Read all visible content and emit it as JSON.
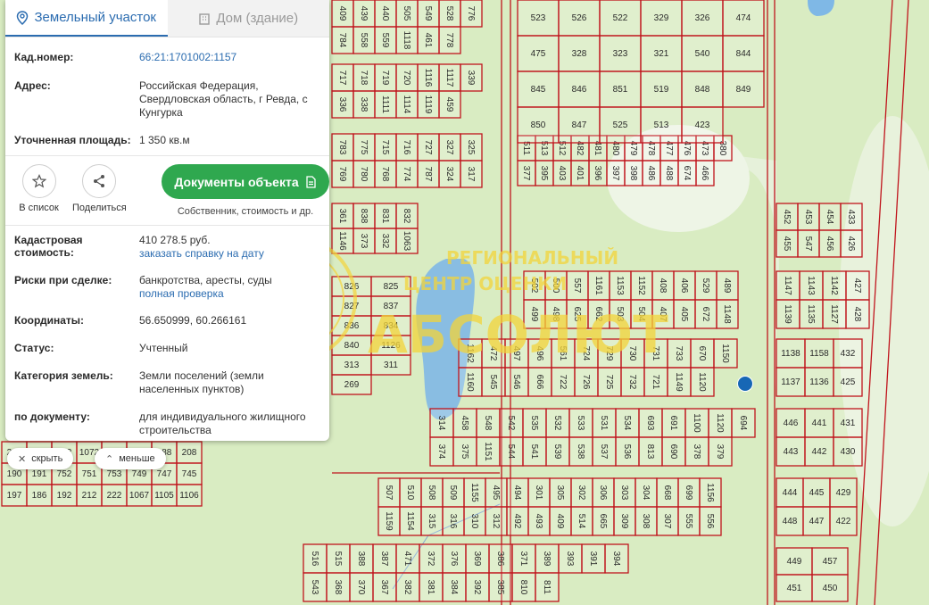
{
  "tabs": [
    {
      "label": "Земельный участок",
      "icon": "location-pin-icon",
      "active": true
    },
    {
      "label": "Дом (здание)",
      "icon": "building-icon",
      "active": false
    }
  ],
  "info": {
    "cad_label": "Кад.номер:",
    "cad_value": "66:21:1701002:1157",
    "addr_label": "Адрес:",
    "addr_value": "Российская Федерация, Свердловская область, г Ревда, с Кунгурка",
    "area_label": "Уточненная площадь:",
    "area_value": "1 350 кв.м",
    "cost_label": "Кадастровая стоимость:",
    "cost_value": "410 278.5 руб.",
    "cost_link": "заказать справку на дату",
    "risk_label": "Риски при сделке:",
    "risk_value": "банкротства, аресты, суды",
    "risk_link": "полная проверка",
    "coord_label": "Координаты:",
    "coord_value": "56.650999, 60.266161",
    "status_label": "Статус:",
    "status_value": "Учтенный",
    "cat_label": "Категория земель:",
    "cat_value": "Земли поселений (земли населенных пунктов)",
    "doc_label": "по документу:",
    "doc_value": "для индивидуального жилищного строительства"
  },
  "actions": {
    "fav_label": "В список",
    "share_label": "Поделиться",
    "docs_button": "Документы объекта",
    "docs_sub": "Собственник, стоимость и др."
  },
  "controls": {
    "hide_label": "скрыть",
    "less_label": "меньше"
  },
  "watermark": {
    "line1": "РЕГИОНАЛЬНЫЙ",
    "line2": "ЦЕНТР ОЦЕНКИ",
    "brand": "АБСОЛЮТ"
  },
  "colors": {
    "accent": "#2b6cb0",
    "button": "#2fa84f",
    "plot_border": "#c0141c",
    "marker": "#1767b5",
    "map_bg": "#d9ecc2"
  },
  "map_labels": {
    "top_rows": [
      "409",
      "439",
      "440",
      "505",
      "549",
      "528",
      "776",
      "784",
      "558",
      "559",
      "1118",
      "461",
      "778"
    ],
    "mid_rows": [
      "717",
      "718",
      "719",
      "720",
      "1116",
      "1117",
      "339",
      "336",
      "338",
      "1111",
      "1114",
      "1119",
      "459"
    ],
    "row3": [
      "783",
      "775",
      "715",
      "716",
      "727",
      "327",
      "325",
      "769",
      "780",
      "768",
      "774",
      "787",
      "324",
      "317"
    ],
    "row4": [
      "361",
      "838",
      "831",
      "832",
      "1146",
      "373",
      "332",
      "1063"
    ],
    "left": [
      "826",
      "825",
      "827",
      "837",
      "836",
      "834",
      "840",
      "1126",
      "313",
      "311",
      "269"
    ],
    "left_bottom": [
      "234",
      "264",
      "262",
      "1072",
      "207",
      "189",
      "188",
      "208",
      "190",
      "191",
      "752",
      "751",
      "753",
      "749",
      "747",
      "745",
      "197",
      "186",
      "192",
      "212",
      "222",
      "1067",
      "1105",
      "1106"
    ],
    "center_top": [
      "511",
      "513",
      "512",
      "482",
      "481",
      "480",
      "479",
      "478",
      "477",
      "476",
      "473",
      "380",
      "377",
      "395",
      "403",
      "401",
      "396",
      "397",
      "398",
      "486",
      "488",
      "674",
      "466"
    ],
    "top_right": [
      "523",
      "526",
      "522",
      "329",
      "326",
      "474",
      "475",
      "328",
      "323",
      "321",
      "540",
      "844",
      "845",
      "846",
      "851",
      "519",
      "848",
      "849",
      "850",
      "847",
      "525",
      "513",
      "423"
    ],
    "right1": [
      "452",
      "453",
      "454",
      "433",
      "455",
      "547",
      "456",
      "426"
    ],
    "block1": [
      "502",
      "500",
      "557",
      "1161",
      "1153",
      "1152",
      "408",
      "406",
      "529",
      "489",
      "499",
      "498",
      "625",
      "662",
      "503",
      "504",
      "407",
      "405",
      "672",
      "1148"
    ],
    "right2": [
      "1147",
      "1143",
      "1142",
      "427",
      "1139",
      "1135",
      "1127",
      "428"
    ],
    "block2": [
      "1162",
      "472",
      "497",
      "496",
      "561",
      "724",
      "729",
      "730",
      "731",
      "733",
      "670",
      "1150",
      "1160",
      "545",
      "546",
      "666",
      "722",
      "726",
      "725",
      "732",
      "721",
      "1149",
      "1120"
    ],
    "right3": [
      "1138",
      "1158",
      "432",
      "1137",
      "1136",
      "425"
    ],
    "block3": [
      "314",
      "458",
      "548",
      "542",
      "535",
      "532",
      "533",
      "531",
      "534",
      "693",
      "691",
      "1100",
      "1120",
      "694",
      "374",
      "375",
      "1151",
      "544",
      "541",
      "539",
      "538",
      "537",
      "536",
      "813",
      "690",
      "378",
      "379"
    ],
    "right4": [
      "446",
      "441",
      "431",
      "443",
      "442",
      "430"
    ],
    "block4": [
      "507",
      "510",
      "508",
      "509",
      "1155",
      "495",
      "494",
      "301",
      "305",
      "302",
      "306",
      "303",
      "304",
      "668",
      "699",
      "1156",
      "1159",
      "1154",
      "315",
      "316",
      "310",
      "312",
      "492",
      "493",
      "409",
      "514",
      "665",
      "309",
      "308",
      "307",
      "555",
      "556"
    ],
    "right5": [
      "444",
      "445",
      "429",
      "448",
      "447",
      "422"
    ],
    "block5": [
      "516",
      "515",
      "388",
      "387",
      "471",
      "372",
      "376",
      "369",
      "386",
      "371",
      "389",
      "393",
      "391",
      "394",
      "543",
      "368",
      "370",
      "367",
      "382",
      "381",
      "384",
      "392",
      "385",
      "810",
      "811"
    ],
    "right6": [
      "449",
      "457",
      "451",
      "450"
    ]
  }
}
